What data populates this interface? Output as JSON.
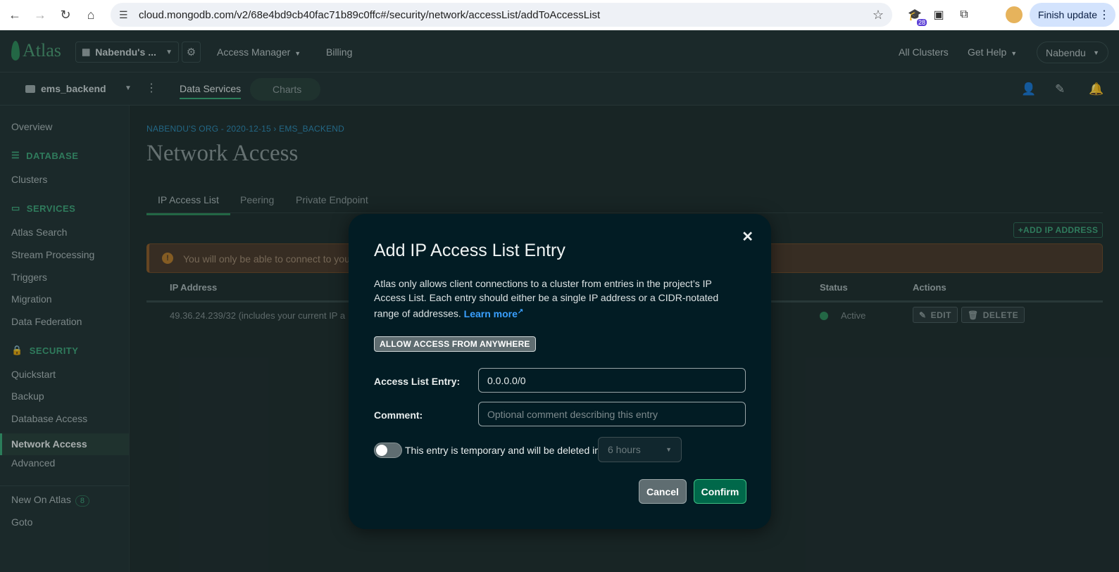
{
  "browser": {
    "url": "cloud.mongodb.com/v2/68e4bd9cb40fac71b89c0ffc#/security/network/accessList/addToAccessList",
    "extension_badge": "28",
    "finish_update_label": "Finish update"
  },
  "topnav": {
    "logo_text": "Atlas",
    "org_name": "Nabendu's ...",
    "access_manager": "Access Manager",
    "billing": "Billing",
    "all_clusters": "All Clusters",
    "get_help": "Get Help",
    "user": "Nabendu"
  },
  "projectbar": {
    "project_name": "ems_backend",
    "data_services_tab": "Data Services",
    "charts_tab": "Charts"
  },
  "sidebar": {
    "overview": "Overview",
    "database_header": "DATABASE",
    "clusters": "Clusters",
    "services_header": "SERVICES",
    "atlas_search": "Atlas Search",
    "stream_processing": "Stream Processing",
    "triggers": "Triggers",
    "migration": "Migration",
    "data_federation": "Data Federation",
    "security_header": "SECURITY",
    "quickstart": "Quickstart",
    "backup": "Backup",
    "database_access": "Database Access",
    "network_access": "Network Access",
    "advanced": "Advanced",
    "new_on_atlas": "New On Atlas",
    "new_on_atlas_count": "8",
    "goto": "Goto"
  },
  "main": {
    "breadcrumb": "NABENDU'S ORG - 2020-12-15 › EMS_BACKEND",
    "title": "Network Access",
    "tabs": [
      "IP Access List",
      "Peering",
      "Private Endpoint"
    ],
    "add_ip_label": "+ADD IP ADDRESS",
    "banner_text": "You will only be able to connect to your",
    "table": {
      "headers": {
        "ip": "IP Address",
        "status": "Status",
        "actions": "Actions"
      },
      "row": {
        "ip": "49.36.24.239/32  (includes your current IP a",
        "status": "Active",
        "edit": "EDIT",
        "delete": "DELETE"
      }
    }
  },
  "modal": {
    "title": "Add IP Access List Entry",
    "description": "Atlas only allows client connections to a cluster from entries in the project’s IP Access List. Each entry should either be a single IP address or a CIDR-notated range of addresses.",
    "learn_more": "Learn more",
    "allow_anywhere": "ALLOW ACCESS FROM ANYWHERE",
    "entry_label": "Access List Entry:",
    "entry_value": "0.0.0.0/0",
    "comment_label": "Comment:",
    "comment_placeholder": "Optional comment describing this entry",
    "temporary_text": "This entry is temporary and will be deleted in",
    "duration": "6 hours",
    "cancel": "Cancel",
    "confirm": "Confirm"
  },
  "colors": {
    "accent_green": "#00684a",
    "link_blue": "#3aa0ff",
    "modal_bg": "#021c24"
  }
}
